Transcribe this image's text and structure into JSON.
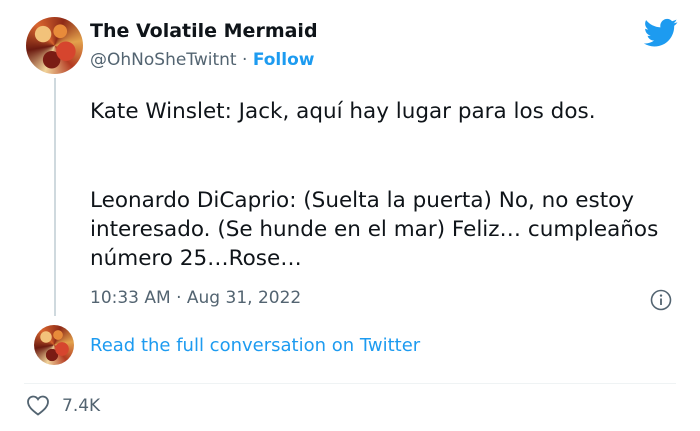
{
  "tweet": {
    "display_name": "The Volatile Mermaid",
    "handle": "@OhNoSheTwitnt",
    "separator": " · ",
    "follow_label": "Follow",
    "text_line_1": "Kate Winslet: Jack, aquí hay lugar para los dos.",
    "text_line_2": "Leonardo DiCaprio: (Suelta la puerta) No, no estoy interesado. (Se hunde en el mar) Feliz… cumpleaños número 25…Rose…",
    "timestamp": "10:33 AM · Aug 31, 2022",
    "read_more_label": "Read the full conversation on Twitter",
    "like_count": "7.4K"
  },
  "icons": {
    "logo": "twitter-bird-icon",
    "info": "info-icon",
    "like": "heart-icon"
  },
  "colors": {
    "accent": "#1d9bf0",
    "text": "#0f1419",
    "secondary": "#536471"
  }
}
